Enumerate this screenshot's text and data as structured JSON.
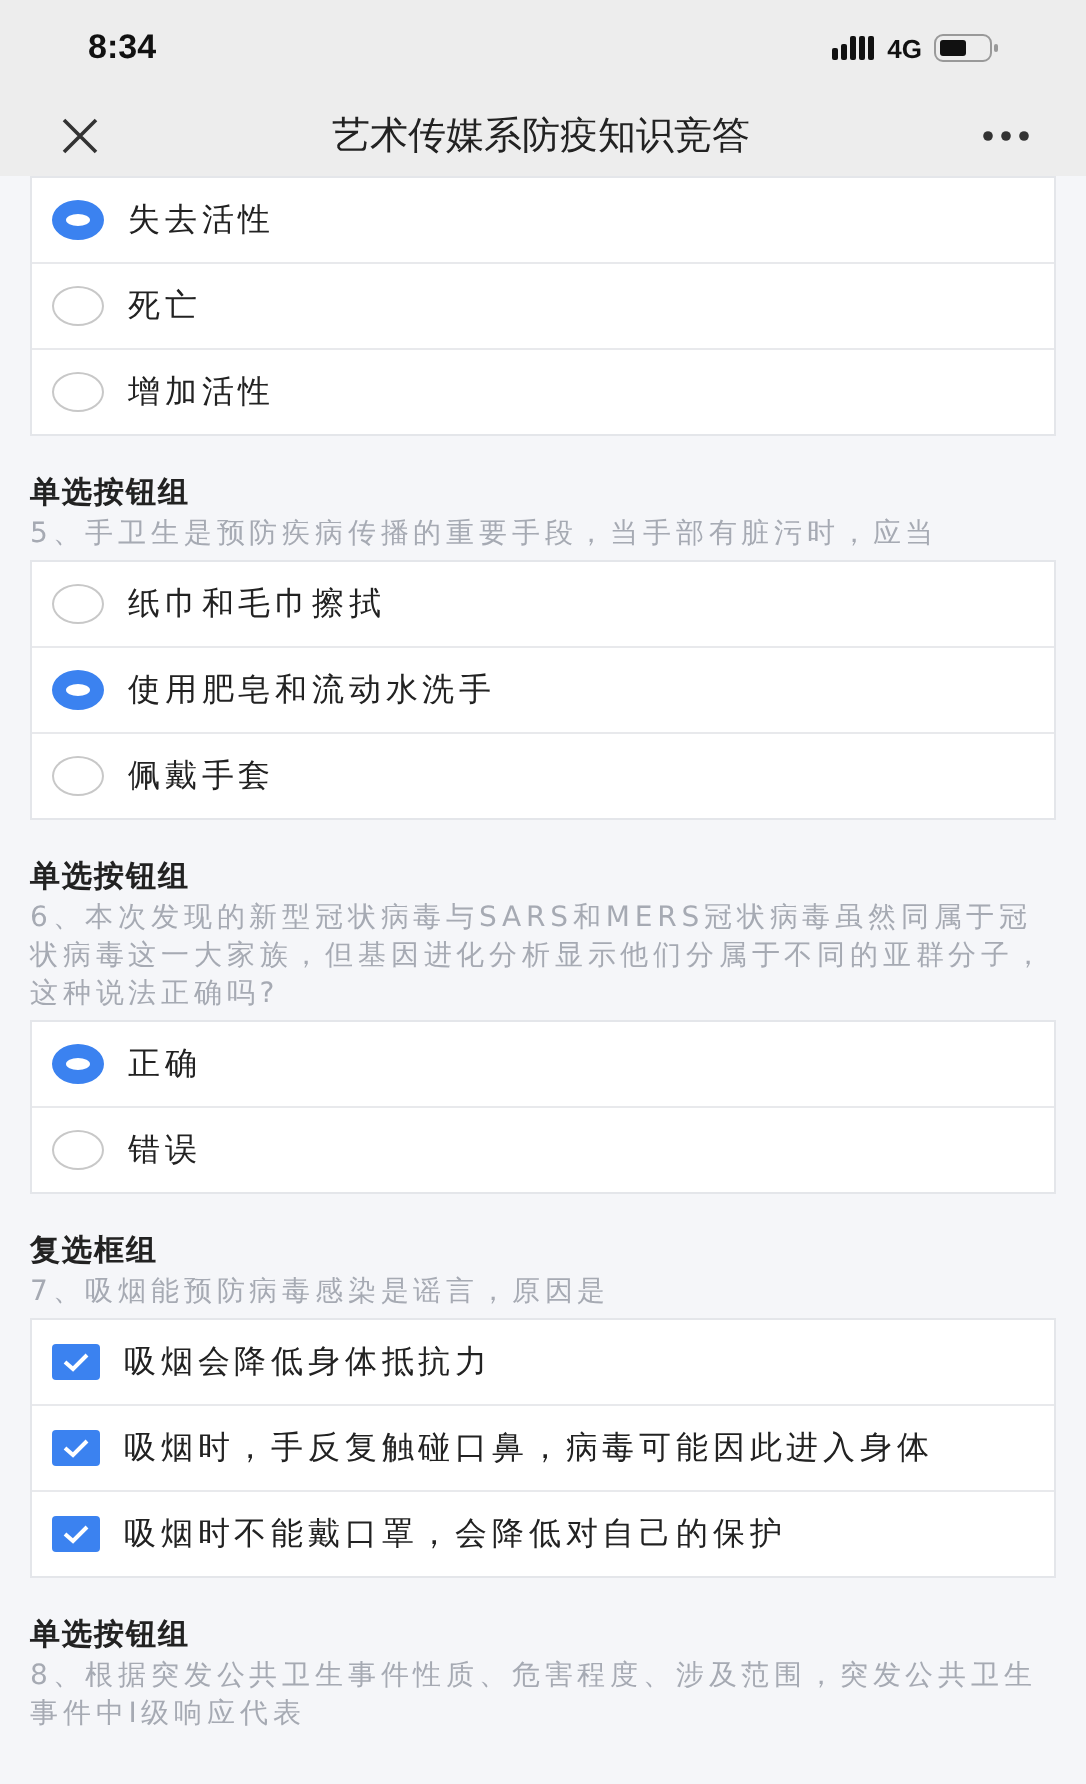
{
  "status_bar": {
    "time": "8:34",
    "network": "4G"
  },
  "nav": {
    "title": "艺术传媒系防疫知识竞答"
  },
  "groups": [
    {
      "kind": "radio",
      "options": [
        {
          "label": "失去活性",
          "selected": true
        },
        {
          "label": "死亡",
          "selected": false
        },
        {
          "label": "增加活性",
          "selected": false
        }
      ]
    },
    {
      "kind": "radio",
      "title": "单选按钮组",
      "question": "5、手卫生是预防疾病传播的重要手段，当手部有脏污时，应当",
      "options": [
        {
          "label": "纸巾和毛巾擦拭",
          "selected": false
        },
        {
          "label": "使用肥皂和流动水洗手",
          "selected": true
        },
        {
          "label": "佩戴手套",
          "selected": false
        }
      ]
    },
    {
      "kind": "radio",
      "title": "单选按钮组",
      "question": "6、本次发现的新型冠状病毒与SARS和MERS冠状病毒虽然同属于冠状病毒这一大家族，但基因进化分析显示他们分属于不同的亚群分子，这种说法正确吗?",
      "options": [
        {
          "label": "正确",
          "selected": true
        },
        {
          "label": "错误",
          "selected": false
        }
      ]
    },
    {
      "kind": "checkbox",
      "title": "复选框组",
      "question": "7、吸烟能预防病毒感染是谣言，原因是",
      "options": [
        {
          "label": "吸烟会降低身体抵抗力",
          "checked": true
        },
        {
          "label": "吸烟时，手反复触碰口鼻，病毒可能因此进入身体",
          "checked": true
        },
        {
          "label": "吸烟时不能戴口罩，会降低对自己的保护",
          "checked": true
        }
      ]
    },
    {
      "title": "单选按钮组",
      "question": "8、根据突发公共卫生事件性质、危害程度、涉及范围，突发公共卫生事件中I级响应代表"
    }
  ]
}
